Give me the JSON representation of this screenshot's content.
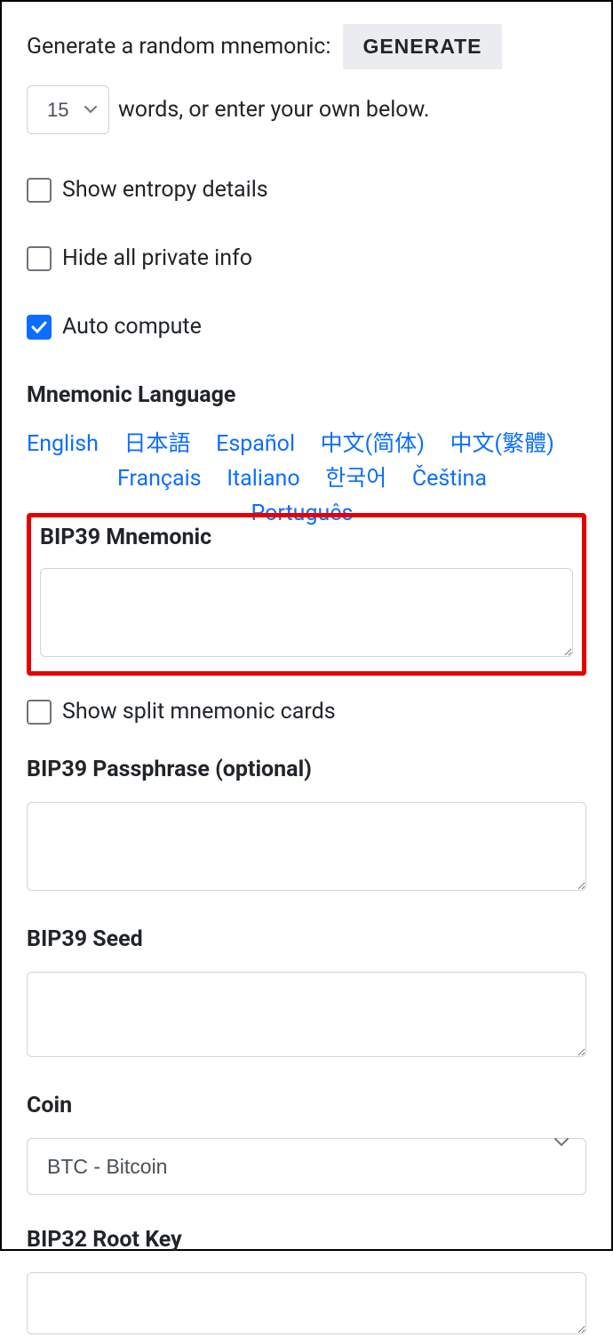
{
  "generate": {
    "label": "Generate a random mnemonic:",
    "button": "GENERATE",
    "word_count": "15",
    "suffix": "words, or enter your own below."
  },
  "checks": {
    "show_entropy": {
      "label": "Show entropy details",
      "checked": false
    },
    "hide_private": {
      "label": "Hide all private info",
      "checked": false
    },
    "auto_compute": {
      "label": "Auto compute",
      "checked": true
    },
    "show_split": {
      "label": "Show split mnemonic cards",
      "checked": false
    }
  },
  "mnemonic_language": {
    "title": "Mnemonic Language",
    "items": [
      "English",
      "日本語",
      "Español",
      "中文(简体)",
      "中文(繁體)",
      "Français",
      "Italiano",
      "한국어",
      "Čeština",
      "Português"
    ]
  },
  "fields": {
    "bip39_mnemonic": {
      "label": "BIP39 Mnemonic",
      "value": ""
    },
    "bip39_passphrase": {
      "label": "BIP39 Passphrase (optional)",
      "value": ""
    },
    "bip39_seed": {
      "label": "BIP39 Seed",
      "value": ""
    },
    "coin": {
      "label": "Coin",
      "value": "BTC - Bitcoin"
    },
    "bip32_root": {
      "label": "BIP32 Root Key",
      "value": ""
    }
  }
}
